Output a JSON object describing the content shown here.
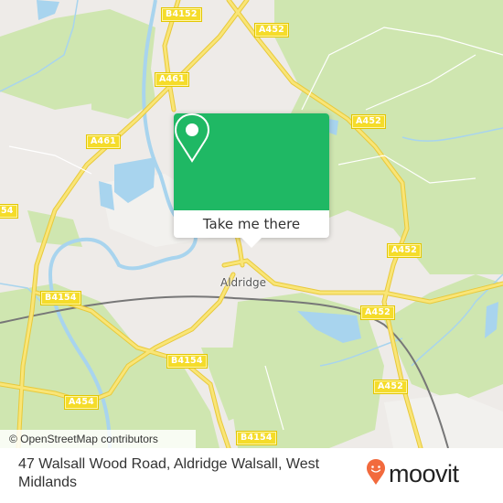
{
  "map": {
    "place_label": "Aldridge",
    "road_labels": [
      {
        "id": "b4152",
        "text": "B4152"
      },
      {
        "id": "a452-top",
        "text": "A452"
      },
      {
        "id": "a461-upper",
        "text": "A461"
      },
      {
        "id": "a452-mid",
        "text": "A452"
      },
      {
        "id": "a461-lower",
        "text": "A461"
      },
      {
        "id": "b4154-left-edge",
        "text": "54"
      },
      {
        "id": "a452-right",
        "text": "A452"
      },
      {
        "id": "b4154-west",
        "text": "B4154"
      },
      {
        "id": "a452-lake",
        "text": "A452"
      },
      {
        "id": "b4154-south",
        "text": "B4154"
      },
      {
        "id": "a452-south",
        "text": "A452"
      },
      {
        "id": "a454",
        "text": "A454"
      },
      {
        "id": "b4154-bottom",
        "text": "B4154"
      }
    ],
    "attribution": "© OpenStreetMap contributors",
    "colors": {
      "land": "#eeebe8",
      "woodland": "#cfe6b0",
      "water": "#a8d4ee",
      "road_major": "#f7dc5a",
      "railway": "#777777"
    }
  },
  "popup": {
    "icon": "map-pin-icon",
    "button_label": "Take me there",
    "accent_color": "#1fb864"
  },
  "footer": {
    "address": "47 Walsall Wood Road, Aldridge Walsall, West Midlands",
    "logo_text": "moovit",
    "logo_icon": "moovit-pin-icon",
    "logo_color": "#f26a3d"
  }
}
